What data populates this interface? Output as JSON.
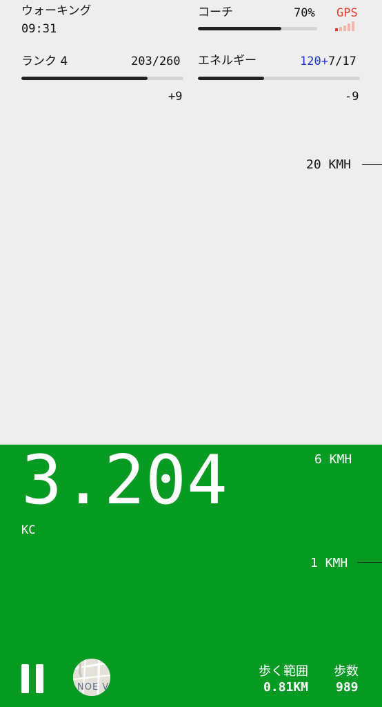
{
  "header": {
    "activity": "ウォーキング",
    "time": "09:31",
    "coach_label": "コーチ",
    "coach_percent": "70%",
    "coach_progress": 0.7,
    "gps_label": "GPS",
    "gps_signal_bars_total": 5,
    "gps_signal_bars_active": 1
  },
  "rank": {
    "label": "ランク 4",
    "value": "203/260",
    "progress": 0.78,
    "delta": "+9"
  },
  "energy": {
    "label": "エネルギー",
    "value_highlight": "120+",
    "value_rest": "7/17",
    "progress": 0.41,
    "delta": "-9"
  },
  "speed_scale": {
    "top": "20 KMH",
    "mid": "6 KMH",
    "low": "1 KMH"
  },
  "main": {
    "value": "3.204",
    "unit": "KC"
  },
  "footer": {
    "distance_label": "歩く範囲",
    "distance_value": "0.81KM",
    "steps_label": "歩数",
    "steps_value": "989",
    "map_text": "NOE V"
  },
  "colors": {
    "background": "#eeeeee",
    "active_zone": "#099a24",
    "gps_red": "#e53a2a",
    "energy_blue": "#1a2fd6"
  }
}
